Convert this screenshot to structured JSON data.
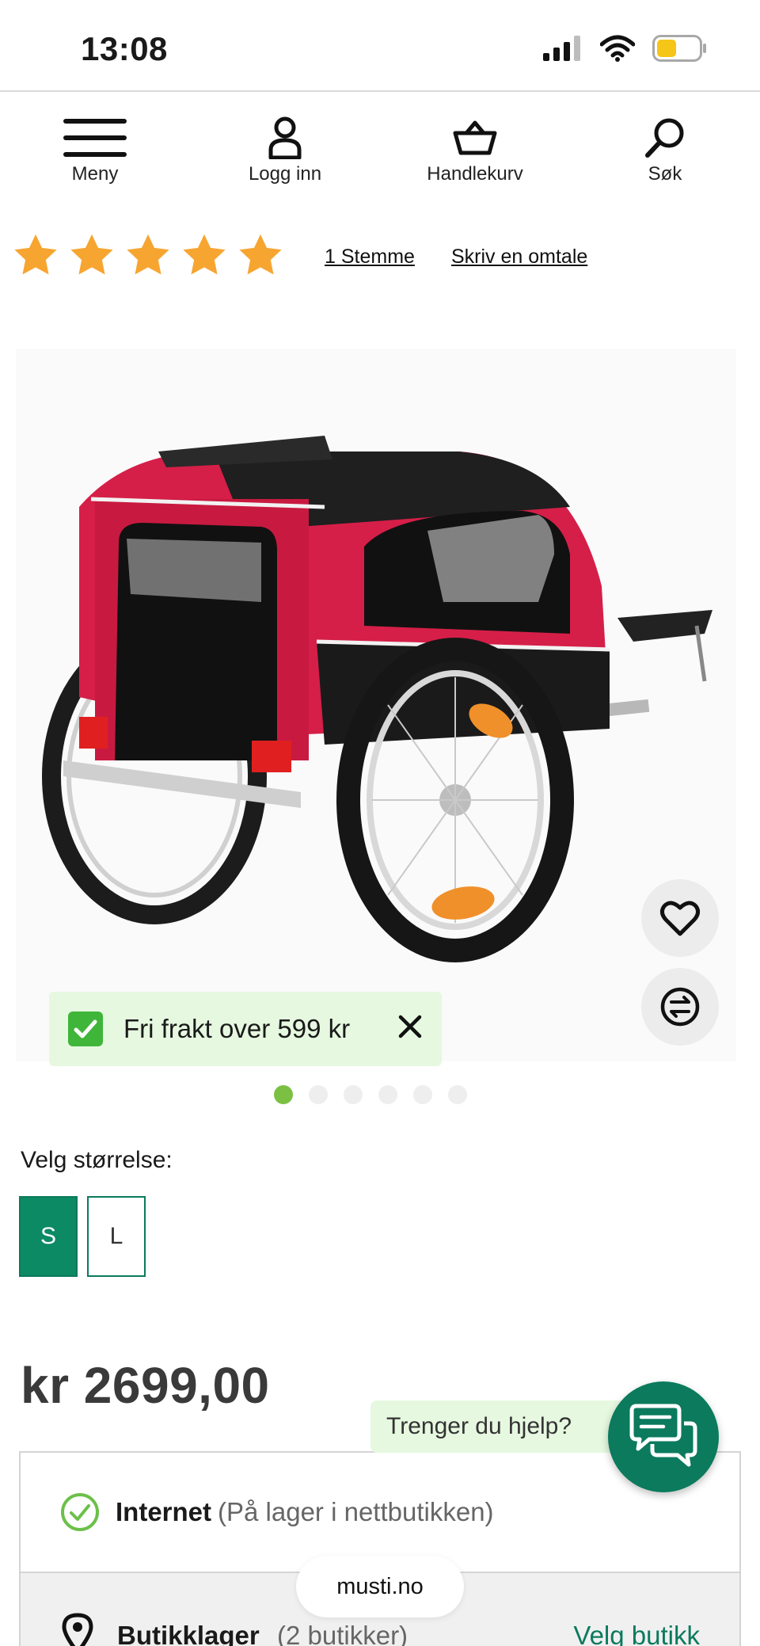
{
  "status_bar": {
    "time": "13:08"
  },
  "nav": {
    "menu": "Meny",
    "login": "Logg inn",
    "cart": "Handlekurv",
    "search": "Søk"
  },
  "rating": {
    "stars": 5,
    "votes_link": "1 Stemme",
    "review_link": "Skriv en omtale",
    "star_color": "#f7a531"
  },
  "gallery": {
    "slides": 6,
    "active_slide": 1
  },
  "promo": {
    "text": "Fri frakt over 599 kr"
  },
  "size": {
    "label": "Velg størrelse:",
    "options": [
      "S",
      "L"
    ],
    "selected": "S"
  },
  "price": "kr 2699,00",
  "help": {
    "text": "Trenger du hjelp?"
  },
  "stock": {
    "internet_label": "Internet",
    "internet_status": "(På lager i nettbutikken)",
    "store_label": "Butikklager",
    "store_status": "(2 butikker)",
    "choose_store": "Velg butikk"
  },
  "browser": {
    "url": "musti.no"
  },
  "colors": {
    "brand_green": "#0b7a5d",
    "accent_green": "#7bc043",
    "promo_bg": "#e6f8e0"
  }
}
